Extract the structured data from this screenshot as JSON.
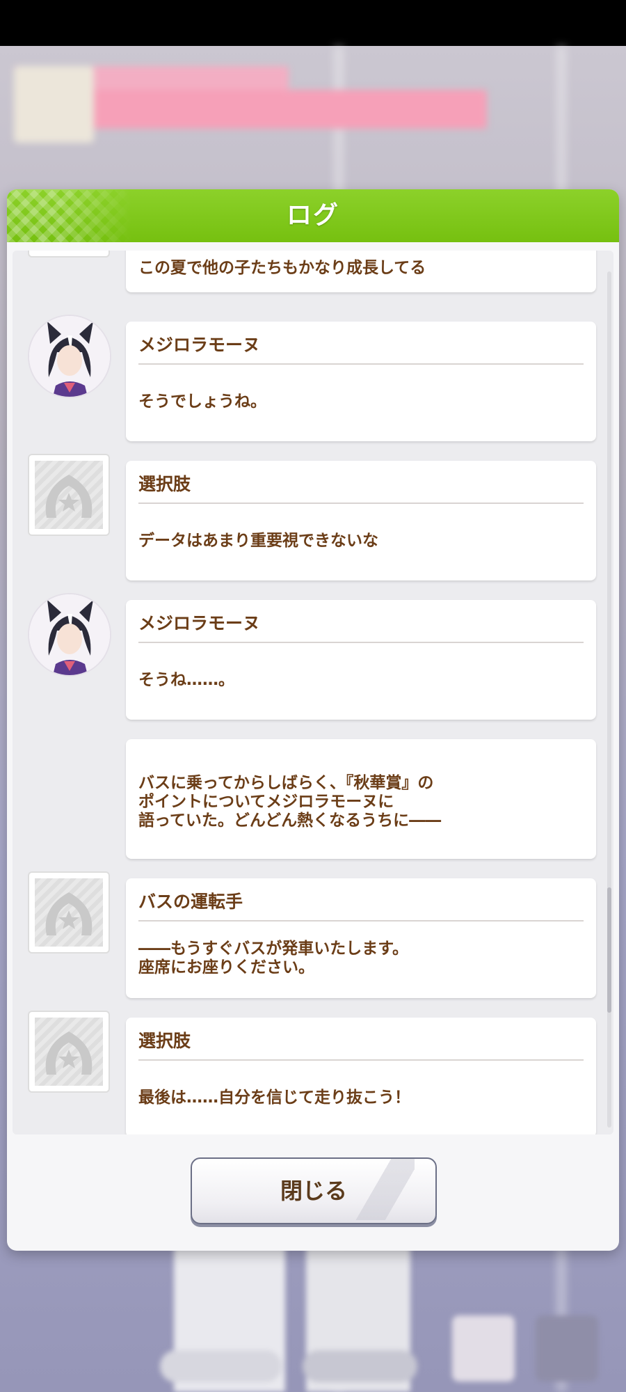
{
  "dialog": {
    "title": "ログ",
    "close_label": "閉じる"
  },
  "log": [
    {
      "speaker": "",
      "avatar": "generic",
      "text": "この夏で他の子たちもかなり成長してる"
    },
    {
      "speaker": "メジロラモーヌ",
      "avatar": "character",
      "text": "そうでしょうね。"
    },
    {
      "speaker": "選択肢",
      "avatar": "generic",
      "text": "データはあまり重要視できないな"
    },
    {
      "speaker": "メジロラモーヌ",
      "avatar": "character",
      "text": "そうね……。"
    },
    {
      "speaker": "",
      "avatar": "none",
      "text": "バスに乗ってからしばらく、『秋華賞』の\nポイントについてメジロラモーヌに\n語っていた。どんどん熱くなるうちに――"
    },
    {
      "speaker": "バスの運転手",
      "avatar": "generic",
      "text": "――もうすぐバスが発車いたします。\n座席にお座りください。"
    },
    {
      "speaker": "選択肢",
      "avatar": "generic",
      "text": "最後は……自分を信じて走り抜こう！"
    }
  ],
  "colors": {
    "header_green": "#7cc51a",
    "text_brown": "#6b3d17"
  }
}
